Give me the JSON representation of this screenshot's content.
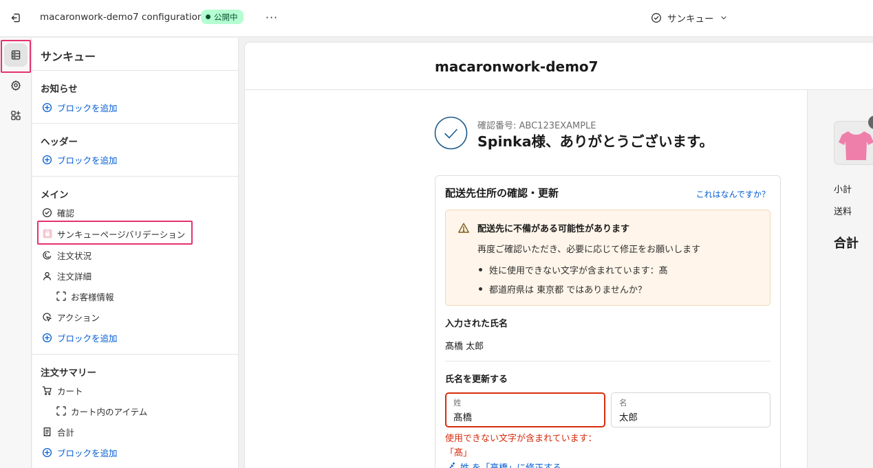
{
  "topbar": {
    "title": "macaronwork-demo7 configuration",
    "status_badge": "公開中",
    "more_label": "···",
    "page_selector": "サンキュー"
  },
  "sidebar": {
    "heading": "サンキュー",
    "sections": [
      {
        "title": "お知らせ",
        "items": [
          {
            "label": "ブロックを追加",
            "icon": "add-circle-icon"
          }
        ]
      },
      {
        "title": "ヘッダー",
        "items": [
          {
            "label": "ブロックを追加",
            "icon": "add-circle-icon"
          }
        ]
      },
      {
        "title": "メイン",
        "items": [
          {
            "label": "確認",
            "icon": "check-circle-icon"
          },
          {
            "label": "サンキューページバリデーション",
            "icon": "app-block-icon"
          },
          {
            "label": "注文状況",
            "icon": "status-icon"
          },
          {
            "label": "注文詳細",
            "icon": "person-icon"
          },
          {
            "label": "お客様情報",
            "icon": "section-dashed-icon"
          },
          {
            "label": "アクション",
            "icon": "cursor-click-icon"
          },
          {
            "label": "ブロックを追加",
            "icon": "add-circle-icon"
          }
        ]
      },
      {
        "title": "注文サマリー",
        "items": [
          {
            "label": "カート",
            "icon": "cart-icon"
          },
          {
            "label": "カート内のアイテム",
            "icon": "section-dashed-icon"
          },
          {
            "label": "合計",
            "icon": "receipt-icon"
          },
          {
            "label": "ブロックを追加",
            "icon": "add-circle-icon"
          }
        ]
      }
    ]
  },
  "preview": {
    "store_name": "macaronwork-demo7",
    "confirmation_number": "確認番号: ABC123EXAMPLE",
    "thanks_message": "Spinka様、ありがとうございます。",
    "card": {
      "title": "配送先住所の確認・更新",
      "help_link": "これはなんですか？",
      "warning": {
        "title": "配送先に不備がある可能性があります",
        "message": "再度ご確認いただき、必要に応じて修正をお願いします",
        "bullets": [
          "姓に使用できない文字が含まれています：髙",
          "都道府県は 東京都 ではありませんか？"
        ]
      },
      "entered_name_label": "入力された氏名",
      "entered_name_value": "髙橋 太郎",
      "update_name_label": "氏名を更新する",
      "last_name": {
        "label": "姓",
        "value": "髙橋"
      },
      "first_name": {
        "label": "名",
        "value": "太郎"
      },
      "error_message": "使用できない文字が含まれています：「髙」",
      "fix_link": "姓 を「高橋」に修正する"
    },
    "summary": {
      "subtotal_label": "小計",
      "shipping_label": "送料",
      "total_label": "合計"
    }
  },
  "colors": {
    "accent_link": "#005bd3",
    "highlight": "#e5316f",
    "error": "#d72c0d",
    "badge_bg": "#b4fed2",
    "warning_bg": "#fff5ea"
  }
}
